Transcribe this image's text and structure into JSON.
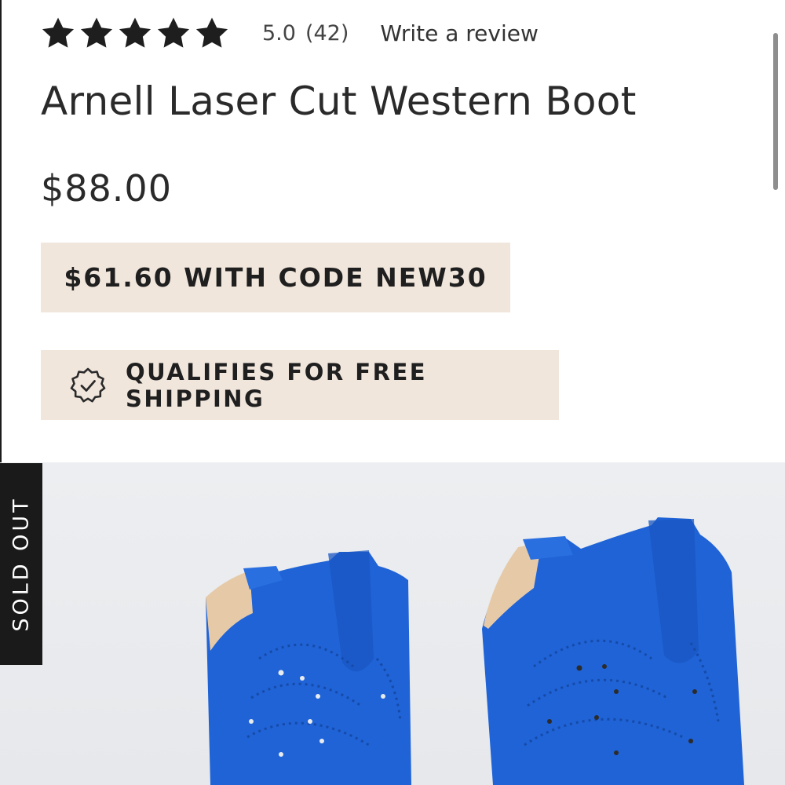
{
  "rating": {
    "stars_filled": 5,
    "stars_total": 5,
    "value": "5.0",
    "count": "(42)",
    "write_review_label": "Write a review"
  },
  "product": {
    "title": "Arnell Laser Cut Western Boot",
    "price": "$88.00",
    "image_icon": "blue-suede-western-boots-photo",
    "image_color": "#1f63d6"
  },
  "promos": {
    "code_offer": "$61.60 WITH CODE NEW30",
    "shipping": "QUALIFIES FOR FREE SHIPPING",
    "shipping_icon": "verified-badge-check-icon",
    "background_color": "#f1e6dc"
  },
  "badge": {
    "sold_out": "SOLD OUT"
  }
}
